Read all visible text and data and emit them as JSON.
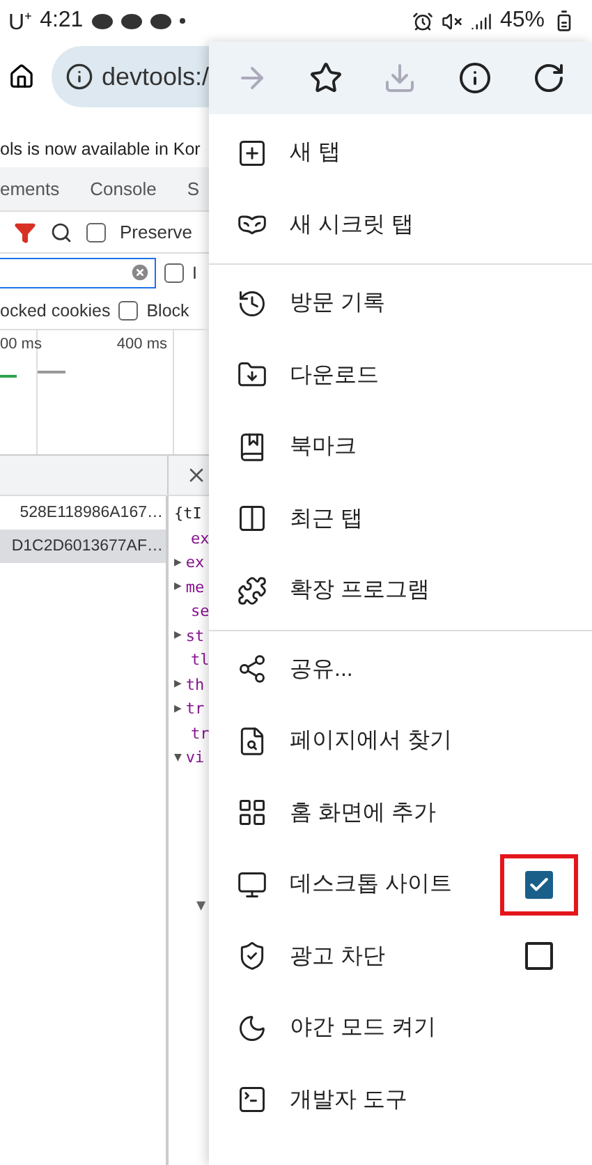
{
  "status_bar": {
    "carrier": "U⁺",
    "time": "4:21",
    "battery": "45%"
  },
  "address_bar": {
    "url": "devtools:/"
  },
  "banner": "ols is now available in Kor",
  "devtools": {
    "tabs": [
      {
        "label": "ements",
        "selected": false
      },
      {
        "label": "Console",
        "selected": false
      },
      {
        "label": "S",
        "selected": false
      }
    ],
    "preserve": {
      "label": "Preserve",
      "checked": false
    },
    "invert": {
      "label": "I",
      "checked": false
    },
    "cookies_text": "ocked cookies",
    "blocked": {
      "label": "Block",
      "checked": false
    },
    "timeline_ticks": [
      "00 ms",
      "400 ms"
    ],
    "requests": [
      {
        "name": "528E118986A167…",
        "selected": false
      },
      {
        "name": "D1C2D6013677AF…",
        "selected": true
      }
    ],
    "preview_lines": [
      {
        "kind": "root",
        "text": "{tI"
      },
      {
        "kind": "prop",
        "text": "ex"
      },
      {
        "kind": "prop",
        "toggle": "▶",
        "text": "ex"
      },
      {
        "kind": "prop",
        "toggle": "▶",
        "text": "me"
      },
      {
        "kind": "prop",
        "text": "se"
      },
      {
        "kind": "prop",
        "toggle": "▶",
        "text": "st"
      },
      {
        "kind": "prop",
        "text": "tl"
      },
      {
        "kind": "prop",
        "toggle": "▶",
        "text": "th"
      },
      {
        "kind": "prop",
        "toggle": "▶",
        "text": "tr"
      },
      {
        "kind": "prop",
        "text": "tr"
      },
      {
        "kind": "prop",
        "toggle": "▼",
        "text": "vi"
      }
    ],
    "lower_toggle": "▼"
  },
  "menu": {
    "top_actions": [
      {
        "disabled": true
      },
      {
        "disabled": false
      },
      {
        "disabled": true
      },
      {
        "disabled": false
      },
      {
        "disabled": false
      }
    ],
    "sections": [
      {
        "items": [
          {
            "kind": "action",
            "label": "새 탭"
          },
          {
            "kind": "action",
            "label": "새 시크릿 탭"
          }
        ]
      },
      {
        "items": [
          {
            "kind": "action",
            "label": "방문 기록"
          },
          {
            "kind": "action",
            "label": "다운로드"
          },
          {
            "kind": "action",
            "label": "북마크"
          },
          {
            "kind": "action",
            "label": "최근 탭"
          },
          {
            "kind": "action",
            "label": "확장 프로그램"
          }
        ]
      },
      {
        "items": [
          {
            "kind": "action",
            "label": "공유..."
          },
          {
            "kind": "action",
            "label": "페이지에서 찾기"
          },
          {
            "kind": "action",
            "label": "홈 화면에 추가"
          },
          {
            "kind": "checkbox",
            "label": "데스크톱 사이트",
            "checked": true,
            "highlighted": true
          },
          {
            "kind": "checkbox",
            "label": "광고 차단",
            "checked": false,
            "highlighted": false
          },
          {
            "kind": "action",
            "label": "야간 모드 켜기"
          },
          {
            "kind": "action",
            "label": "개발자 도구"
          }
        ]
      }
    ]
  }
}
